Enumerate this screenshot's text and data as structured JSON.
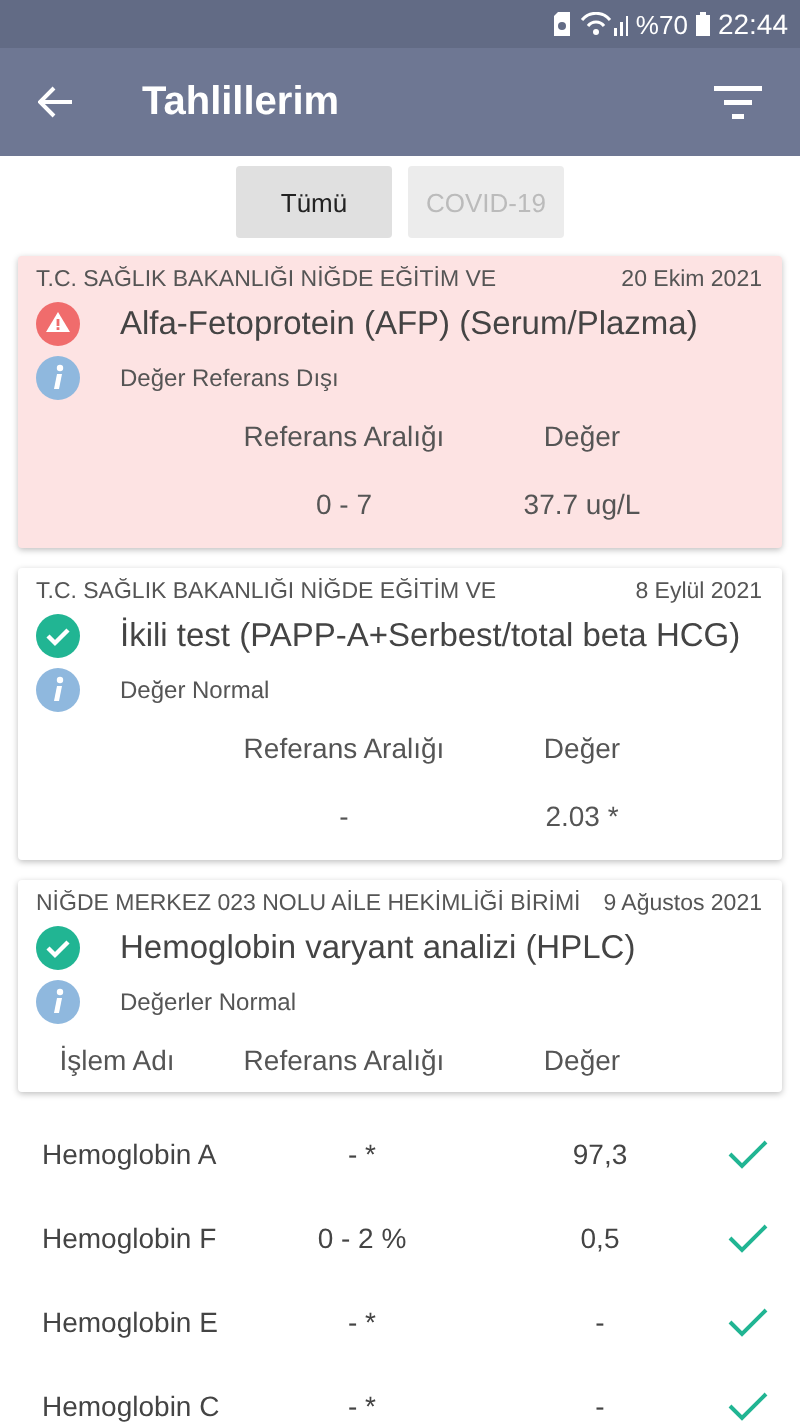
{
  "status_bar": {
    "battery_text": "%70",
    "time": "22:44"
  },
  "app_bar": {
    "title": "Tahlillerim"
  },
  "filters": [
    {
      "label": "Tümü",
      "selected": true
    },
    {
      "label": "COVID-19",
      "selected": false
    }
  ],
  "results": [
    {
      "kind": "single",
      "alert": true,
      "institution": "T.C. SAĞLIK BAKANLIĞI NİĞDE EĞİTİM VE",
      "date": "20 Ekim 2021",
      "test": "Alfa-Fetoprotein (AFP) (Serum/Plazma)",
      "note": "Değer Referans Dışı",
      "columns": [
        "Referans Aralığı",
        "Değer"
      ],
      "values": [
        "0 - 7",
        "37.7 ug/L"
      ]
    },
    {
      "kind": "single",
      "alert": false,
      "institution": "T.C. SAĞLIK BAKANLIĞI NİĞDE EĞİTİM VE",
      "date": "8 Eylül 2021",
      "test": "İkili test (PAPP-A+Serbest/total beta HCG)",
      "note": "Değer Normal",
      "columns": [
        "Referans Aralığı",
        "Değer"
      ],
      "values": [
        "-",
        "2.03 *"
      ]
    },
    {
      "kind": "panel",
      "alert": false,
      "institution": "NİĞDE MERKEZ 023 NOLU AİLE HEKİMLİĞİ BİRİMİ",
      "date": "9 Ağustos 2021",
      "test": "Hemoglobin varyant analizi (HPLC)",
      "note": "Değerler Normal",
      "columns": [
        "İşlem Adı",
        "Referans Aralığı",
        "Değer"
      ],
      "rows": [
        {
          "name": "Hemoglobin A",
          "range": "-  *",
          "value": "97,3",
          "normal": true
        },
        {
          "name": "Hemoglobin F",
          "range": "0 - 2  %",
          "value": "0,5",
          "normal": true
        },
        {
          "name": "Hemoglobin E",
          "range": "-  *",
          "value": "-",
          "normal": true
        },
        {
          "name": "Hemoglobin C",
          "range": "-  *",
          "value": "-",
          "normal": true
        }
      ]
    }
  ]
}
